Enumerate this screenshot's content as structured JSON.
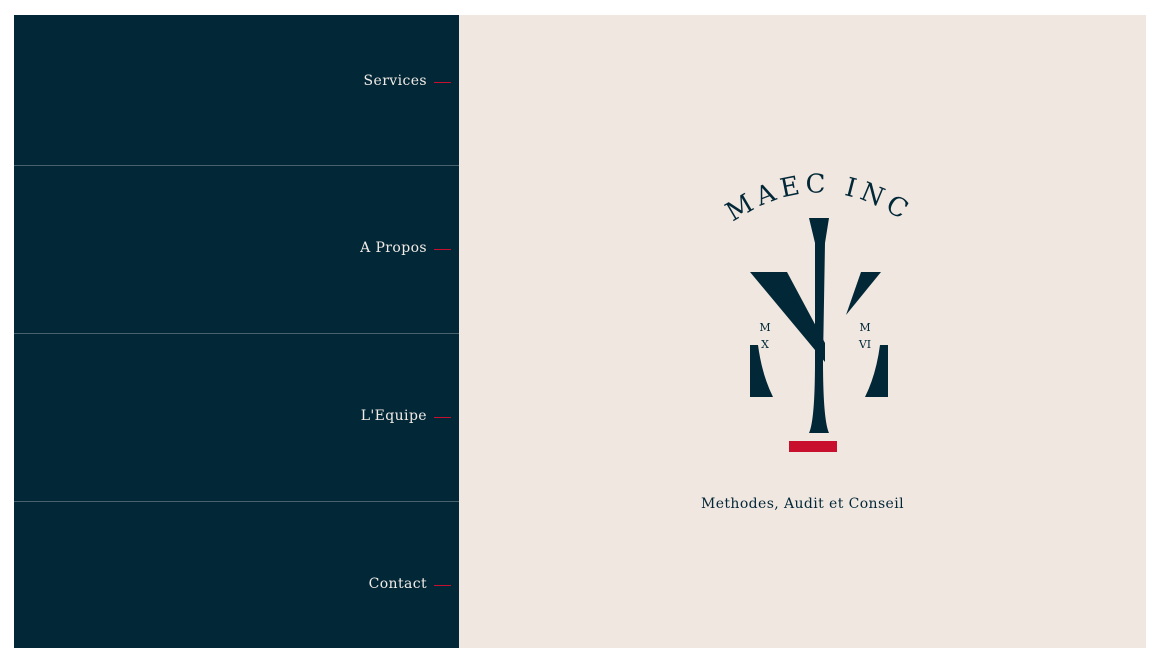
{
  "nav": {
    "items": [
      {
        "label": "Services"
      },
      {
        "label": "A Propos"
      },
      {
        "label": "L'Equipe"
      },
      {
        "label": "Contact"
      }
    ]
  },
  "brand": {
    "name": "MAEC INC",
    "year_left_top": "M",
    "year_left_bottom": "X",
    "year_right_top": "M",
    "year_right_bottom": "VI",
    "tagline": "Methodes, Audit et Conseil"
  },
  "colors": {
    "nav_background": "#022838",
    "hero_background": "#f1e7e1",
    "accent": "#c8102e",
    "text_light": "#f3ece6",
    "text_dark": "#022838"
  }
}
